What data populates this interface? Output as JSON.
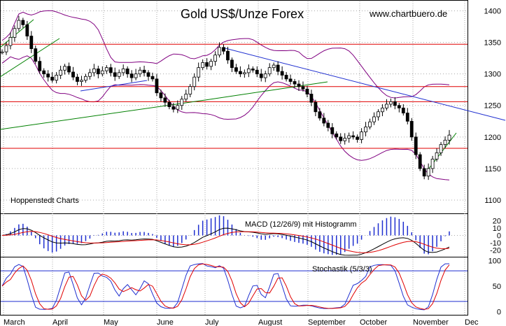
{
  "header": {
    "title": "Gold US$/Unze Forex",
    "site": "www.chartbuero.de",
    "source": "Hoppenstedt Charts"
  },
  "colors": {
    "price_bar": "#000000",
    "bollinger": "#800080",
    "horizontal_line": "#e00000",
    "down_trend": "#1f2fd0",
    "up_trend": "#008000",
    "grid": "#aaaaaa",
    "macd_line": "#000000",
    "signal_line": "#e00000",
    "histogram": "#1f2fd0",
    "stoch_k": "#1f2fd0",
    "stoch_d": "#e00000"
  },
  "chart_data": [
    {
      "type": "candlestick",
      "title": "Gold US$/Unze Forex",
      "x_months": [
        "March",
        "April",
        "May",
        "June",
        "July",
        "August",
        "September",
        "October",
        "November",
        "Dec"
      ],
      "y_ticks": [
        1100,
        1150,
        1200,
        1250,
        1300,
        1350,
        1400
      ],
      "ylim": [
        1080,
        1415
      ],
      "horizontal_lines": [
        1347,
        1280,
        1256,
        1182
      ],
      "close_series": [
        1335,
        1345,
        1358,
        1372,
        1385,
        1378,
        1360,
        1340,
        1320,
        1305,
        1300,
        1295,
        1290,
        1298,
        1306,
        1312,
        1303,
        1295,
        1288,
        1290,
        1296,
        1302,
        1308,
        1300,
        1305,
        1310,
        1302,
        1296,
        1302,
        1308,
        1300,
        1294,
        1300,
        1306,
        1302,
        1296,
        1292,
        1270,
        1262,
        1255,
        1248,
        1244,
        1250,
        1260,
        1268,
        1280,
        1295,
        1310,
        1318,
        1312,
        1320,
        1330,
        1342,
        1336,
        1322,
        1310,
        1304,
        1300,
        1302,
        1308,
        1306,
        1300,
        1294,
        1300,
        1310,
        1314,
        1304,
        1298,
        1292,
        1288,
        1284,
        1280,
        1276,
        1268,
        1255,
        1240,
        1230,
        1222,
        1215,
        1205,
        1200,
        1194,
        1198,
        1202,
        1200,
        1196,
        1208,
        1216,
        1224,
        1232,
        1240,
        1246,
        1252,
        1256,
        1250,
        1246,
        1238,
        1225,
        1200,
        1172,
        1150,
        1138,
        1150,
        1165,
        1175,
        1188,
        1195,
        1203
      ]
    },
    {
      "type": "line",
      "title": "MACD (12/26/9) mit Histogramm",
      "y_ticks": [
        20,
        10,
        0,
        -10,
        -20
      ],
      "ylim": [
        -28,
        28
      ],
      "series": [
        {
          "values": []
        },
        {
          "values": []
        }
      ]
    },
    {
      "type": "line",
      "title": "Stochastik (5/3/3)",
      "y_ticks": [
        100,
        50,
        0
      ],
      "ylim": [
        -5,
        105
      ],
      "reference_lines": [
        80,
        20
      ],
      "series": [
        {
          "values": []
        },
        {
          "values": []
        }
      ]
    }
  ]
}
